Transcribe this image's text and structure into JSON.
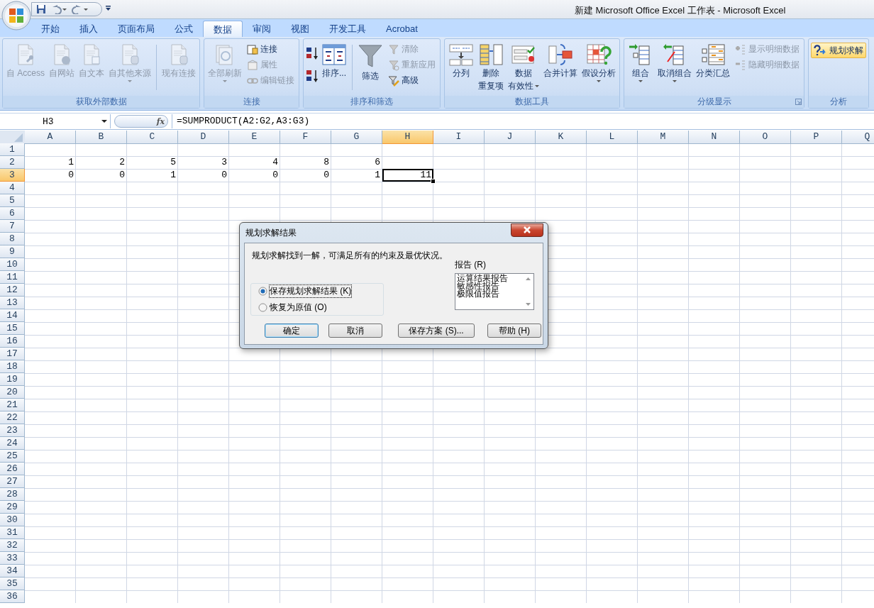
{
  "title_bar": {
    "title": "新建 Microsoft Office Excel 工作表 - Microsoft Excel"
  },
  "tabs": [
    {
      "label": "开始",
      "selected": false
    },
    {
      "label": "插入",
      "selected": false
    },
    {
      "label": "页面布局",
      "selected": false
    },
    {
      "label": "公式",
      "selected": false
    },
    {
      "label": "数据",
      "selected": true
    },
    {
      "label": "审阅",
      "selected": false
    },
    {
      "label": "视图",
      "selected": false
    },
    {
      "label": "开发工具",
      "selected": false
    },
    {
      "label": "Acrobat",
      "selected": false
    }
  ],
  "ribbon": {
    "groups": [
      {
        "label": "获取外部数据",
        "launcher": false,
        "buttons": [
          {
            "kind": "large",
            "label": "自 Access",
            "disabled": true,
            "dropdown": false
          },
          {
            "kind": "large",
            "label": "自网站",
            "disabled": true,
            "dropdown": false
          },
          {
            "kind": "large",
            "label": "自文本",
            "disabled": true,
            "dropdown": false
          },
          {
            "kind": "large",
            "label": "自其他来源",
            "disabled": true,
            "dropdown": true
          },
          {
            "kind": "separator"
          },
          {
            "kind": "large",
            "label": "现有连接",
            "disabled": true,
            "dropdown": false
          }
        ]
      },
      {
        "label": "连接",
        "launcher": false,
        "buttons": [
          {
            "kind": "large",
            "label": "全部刷新",
            "disabled": true,
            "dropdown": true
          },
          {
            "kind": "stack",
            "items": [
              {
                "label": "连接",
                "disabled": false
              },
              {
                "label": "属性",
                "disabled": true
              },
              {
                "label": "编辑链接",
                "disabled": true
              }
            ]
          }
        ]
      },
      {
        "label": "排序和筛选",
        "launcher": false,
        "buttons": [
          {
            "kind": "sortpair"
          },
          {
            "kind": "large",
            "label": "排序...",
            "disabled": false,
            "dropdown": false
          },
          {
            "kind": "separator"
          },
          {
            "kind": "large",
            "label": "筛选",
            "disabled": false,
            "dropdown": false
          },
          {
            "kind": "stack",
            "items": [
              {
                "label": "清除",
                "disabled": true
              },
              {
                "label": "重新应用",
                "disabled": true
              },
              {
                "label": "高级",
                "disabled": false
              }
            ]
          }
        ]
      },
      {
        "label": "数据工具",
        "launcher": false,
        "buttons": [
          {
            "kind": "large",
            "label": "分列",
            "disabled": false,
            "dropdown": false
          },
          {
            "kind": "large",
            "lines": [
              "删除",
              "重复项"
            ],
            "disabled": false,
            "dropdown": false
          },
          {
            "kind": "large",
            "lines": [
              "数据",
              "有效性"
            ],
            "disabled": false,
            "dropdown": true
          },
          {
            "kind": "large",
            "label": "合并计算",
            "disabled": false,
            "dropdown": false
          },
          {
            "kind": "large",
            "label": "假设分析",
            "disabled": false,
            "dropdown": true
          }
        ]
      },
      {
        "label": "分级显示",
        "launcher": true,
        "buttons": [
          {
            "kind": "large",
            "label": "组合",
            "disabled": false,
            "dropdown": true
          },
          {
            "kind": "large",
            "label": "取消组合",
            "disabled": false,
            "dropdown": true
          },
          {
            "kind": "large",
            "label": "分类汇总",
            "disabled": false,
            "dropdown": false
          },
          {
            "kind": "stack",
            "items": [
              {
                "label": "显示明细数据",
                "disabled": true
              },
              {
                "label": "隐藏明细数据",
                "disabled": true
              }
            ]
          }
        ]
      },
      {
        "label": "分析",
        "launcher": false,
        "buttons": [
          {
            "kind": "highlight",
            "label": "规划求解"
          }
        ]
      }
    ]
  },
  "formula_bar": {
    "name_box": "H3",
    "function_button": "fx",
    "formula": "=SUMPRODUCT(A2:G2,A3:G3)"
  },
  "sheet": {
    "columns": [
      {
        "label": "A",
        "selected": false
      },
      {
        "label": "B",
        "selected": false
      },
      {
        "label": "C",
        "selected": false
      },
      {
        "label": "D",
        "selected": false
      },
      {
        "label": "E",
        "selected": false
      },
      {
        "label": "F",
        "selected": false
      },
      {
        "label": "G",
        "selected": false
      },
      {
        "label": "H",
        "selected": true
      },
      {
        "label": "I",
        "selected": false
      },
      {
        "label": "J",
        "selected": false
      },
      {
        "label": "K",
        "selected": false
      },
      {
        "label": "L",
        "selected": false
      },
      {
        "label": "M",
        "selected": false
      },
      {
        "label": "N",
        "selected": false
      },
      {
        "label": "O",
        "selected": false
      },
      {
        "label": "P",
        "selected": false
      },
      {
        "label": "Q",
        "selected": false
      }
    ],
    "rows": [
      {
        "label": "1",
        "selected": false
      },
      {
        "label": "2",
        "selected": false,
        "cells": [
          {
            "value": "1",
            "selected": false
          },
          {
            "value": "2",
            "selected": false
          },
          {
            "value": "5",
            "selected": false
          },
          {
            "value": "3",
            "selected": false
          },
          {
            "value": "4",
            "selected": false
          },
          {
            "value": "8",
            "selected": false
          },
          {
            "value": "6",
            "selected": false
          }
        ]
      },
      {
        "label": "3",
        "selected": true,
        "cells": [
          {
            "value": "0",
            "selected": false
          },
          {
            "value": "0",
            "selected": false
          },
          {
            "value": "1",
            "selected": false
          },
          {
            "value": "0",
            "selected": false
          },
          {
            "value": "0",
            "selected": false
          },
          {
            "value": "0",
            "selected": false
          },
          {
            "value": "1",
            "selected": false
          },
          {
            "value": "11",
            "selected": true
          }
        ]
      },
      {
        "label": "4",
        "selected": false
      },
      {
        "label": "5",
        "selected": false
      },
      {
        "label": "6",
        "selected": false
      },
      {
        "label": "7",
        "selected": false
      },
      {
        "label": "8",
        "selected": false
      },
      {
        "label": "9",
        "selected": false
      },
      {
        "label": "10",
        "selected": false
      },
      {
        "label": "11",
        "selected": false
      },
      {
        "label": "12",
        "selected": false
      },
      {
        "label": "13",
        "selected": false
      },
      {
        "label": "14",
        "selected": false
      },
      {
        "label": "15",
        "selected": false
      },
      {
        "label": "16",
        "selected": false
      },
      {
        "label": "17",
        "selected": false
      },
      {
        "label": "18",
        "selected": false
      },
      {
        "label": "19",
        "selected": false
      },
      {
        "label": "20",
        "selected": false
      },
      {
        "label": "21",
        "selected": false
      },
      {
        "label": "22",
        "selected": false
      },
      {
        "label": "23",
        "selected": false
      },
      {
        "label": "24",
        "selected": false
      },
      {
        "label": "25",
        "selected": false
      },
      {
        "label": "26",
        "selected": false
      },
      {
        "label": "27",
        "selected": false
      },
      {
        "label": "28",
        "selected": false
      },
      {
        "label": "29",
        "selected": false
      },
      {
        "label": "30",
        "selected": false
      },
      {
        "label": "31",
        "selected": false
      },
      {
        "label": "32",
        "selected": false
      },
      {
        "label": "33",
        "selected": false
      },
      {
        "label": "34",
        "selected": false
      },
      {
        "label": "35",
        "selected": false
      },
      {
        "label": "36",
        "selected": false
      }
    ]
  },
  "dialog": {
    "title": "规划求解结果",
    "message": "规划求解找到一解，可满足所有的约束及最优状况。",
    "options": [
      {
        "label": "保存规划求解结果 (K)",
        "selected": true
      },
      {
        "label": "恢复为原值 (O)",
        "selected": false
      }
    ],
    "report_label": "报告 (R)",
    "reports": [
      {
        "label": "运算结果报告",
        "selected": false
      },
      {
        "label": "敏感性报告",
        "selected": false
      },
      {
        "label": "极限值报告",
        "selected": false
      }
    ],
    "buttons": [
      {
        "label": "确定",
        "default": true
      },
      {
        "label": "取消",
        "default": false
      },
      {
        "label": "保存方案 (S)...",
        "default": false
      },
      {
        "label": "帮助 (H)",
        "default": false
      }
    ]
  }
}
